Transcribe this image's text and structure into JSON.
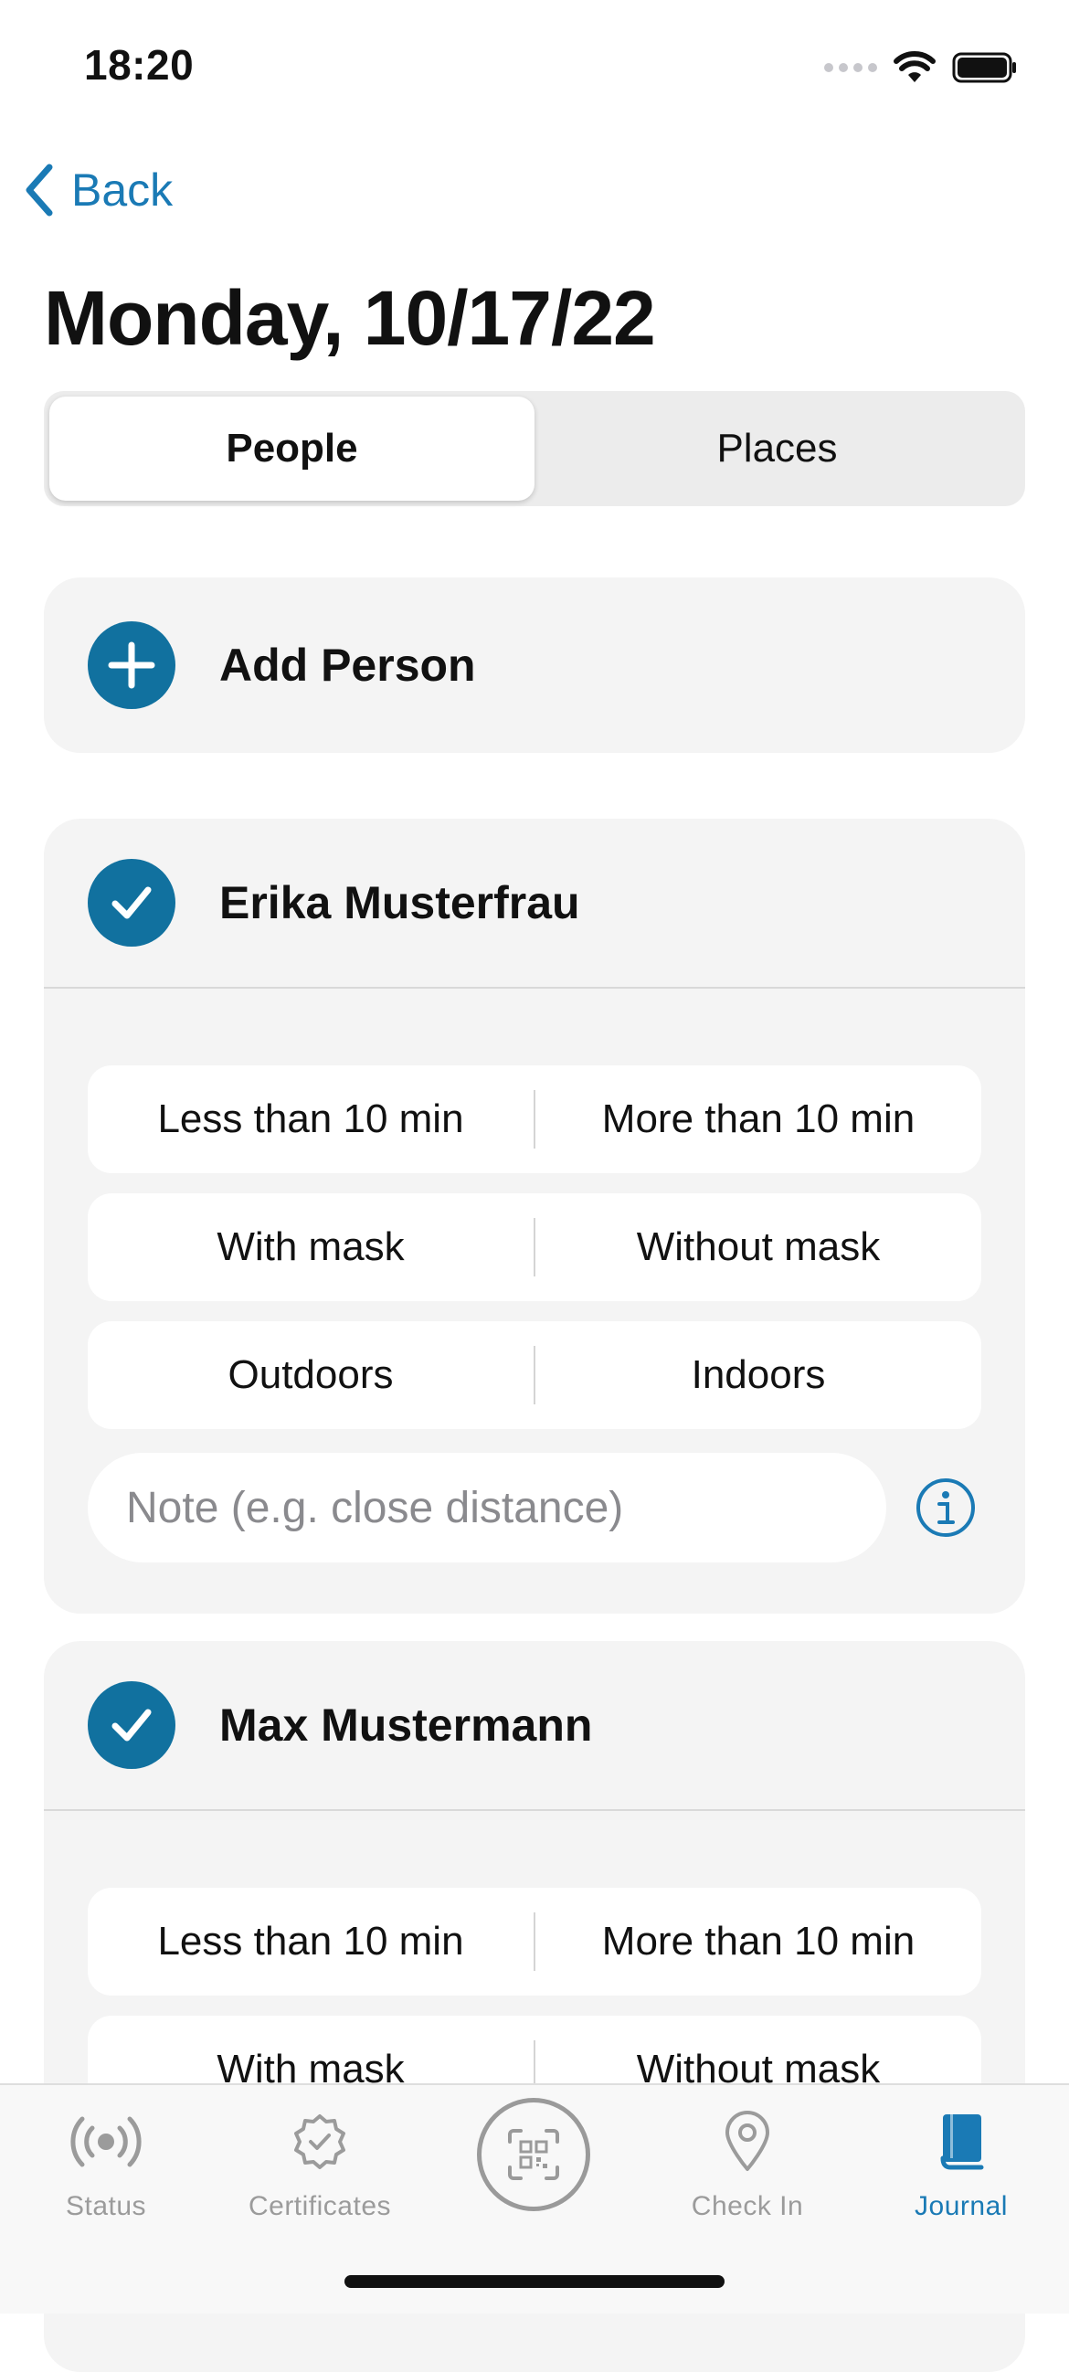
{
  "status_bar": {
    "time": "18:20"
  },
  "nav": {
    "back_label": "Back"
  },
  "header": {
    "title": "Monday, 10/17/22"
  },
  "segments": {
    "people": "People",
    "places": "Places",
    "selected": "People"
  },
  "add_person": {
    "label": "Add Person"
  },
  "persons": [
    {
      "name": "Erika Musterfrau",
      "checked": true,
      "duration": [
        "Less than 10 min",
        "More than 10 min"
      ],
      "mask": [
        "With mask",
        "Without mask"
      ],
      "location": [
        "Outdoors",
        "Indoors"
      ],
      "note_placeholder": "Note (e.g. close distance)",
      "note_value": ""
    },
    {
      "name": "Max Mustermann",
      "checked": true,
      "duration": [
        "Less than 10 min",
        "More than 10 min"
      ],
      "mask": [
        "With mask",
        "Without mask"
      ]
    }
  ],
  "tab_bar": {
    "tabs": [
      {
        "label": "Status",
        "icon": "broadcast-icon"
      },
      {
        "label": "Certificates",
        "icon": "certificate-badge-icon"
      },
      {
        "label": "",
        "icon": "qr-scan-icon"
      },
      {
        "label": "Check In",
        "icon": "location-pin-icon"
      },
      {
        "label": "Journal",
        "icon": "journal-book-icon"
      }
    ],
    "active": "Journal"
  },
  "colors": {
    "accent": "#1a7ab5",
    "icon_fill": "#11719f",
    "card_bg": "#f4f4f4",
    "inactive_tab": "#9b9b9b"
  }
}
